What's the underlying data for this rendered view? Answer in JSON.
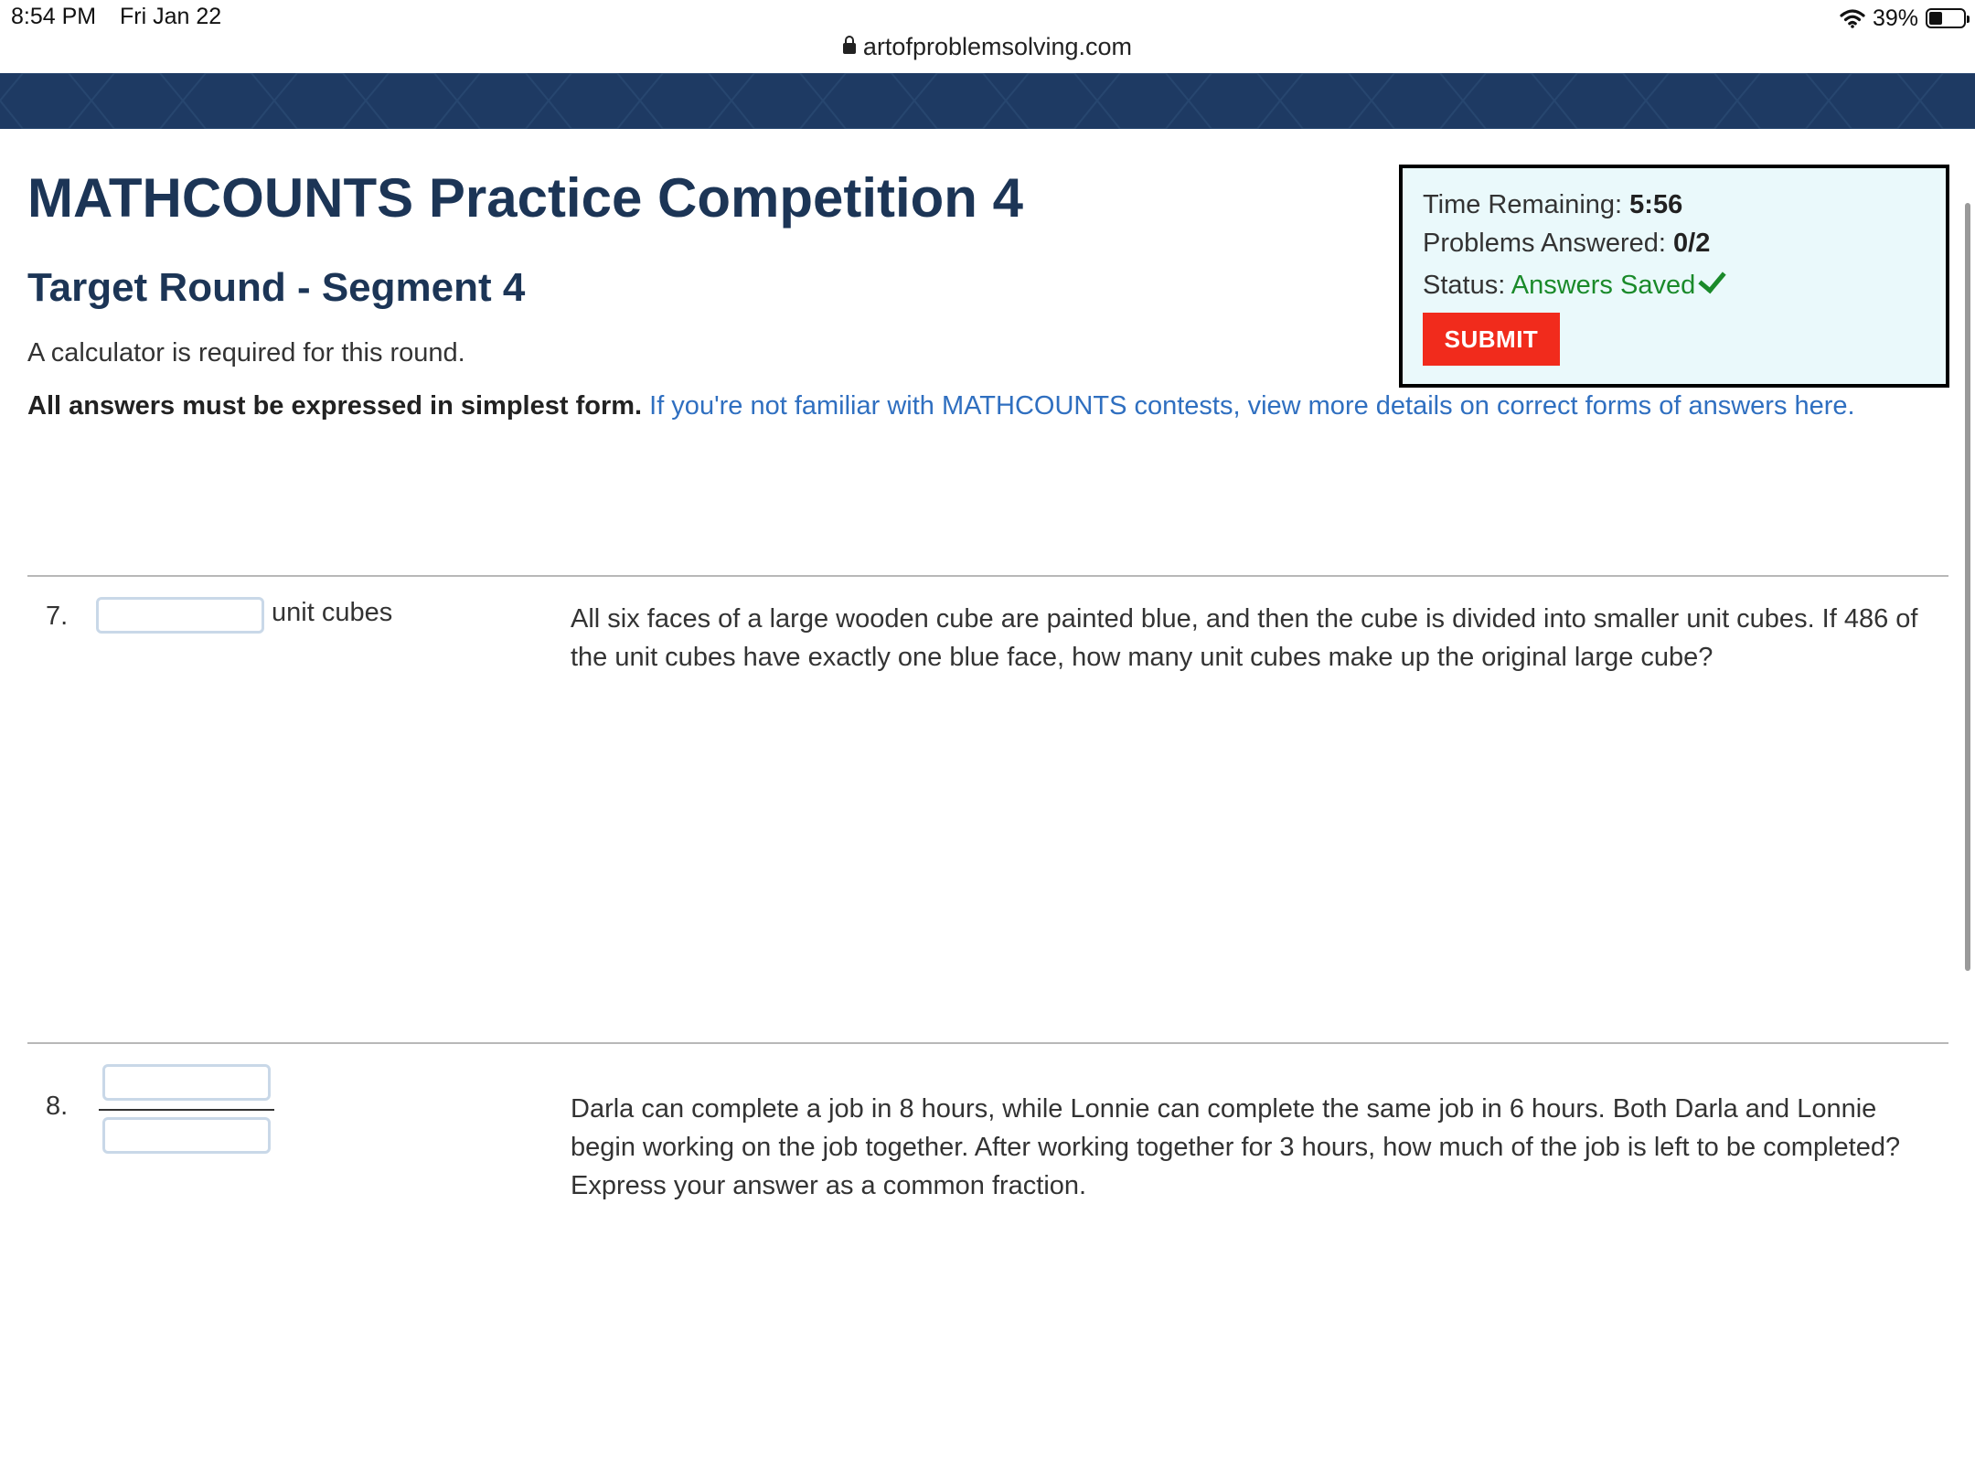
{
  "status_bar": {
    "time": "8:54 PM",
    "date": "Fri Jan 22",
    "url": "artofproblemsolving.com",
    "battery": "39%"
  },
  "page": {
    "title": "MATHCOUNTS Practice Competition 4",
    "round_title": "Target Round - Segment 4",
    "calculator_note": "A calculator is required for this round.",
    "answers_bold": "All answers must be expressed in simplest form.",
    "answers_link": "If you're not familiar with MATHCOUNTS contests, view more details on correct forms of answers here."
  },
  "status_box": {
    "time_label": "Time Remaining: ",
    "time_value": "5:56",
    "answered_label": "Problems Answered: ",
    "answered_value": "0/2",
    "status_label": "Status: ",
    "status_value": "Answers Saved",
    "submit_label": "SUBMIT"
  },
  "problems": [
    {
      "number": "7.",
      "answer_value": "",
      "unit": "unit cubes",
      "text": "All six faces of a large wooden cube are painted blue, and then the cube is divided into smaller unit cubes. If 486 of the unit cubes have exactly one blue face, how many unit cubes make up the original large cube?"
    },
    {
      "number": "8.",
      "numerator_value": "",
      "denominator_value": "",
      "text": "Darla can complete a job in 8 hours, while Lonnie can complete the same job in 6 hours. Both Darla and Lonnie begin working on the job together. After working together for 3 hours, how much of the job is left to be completed? Express your answer as a common fraction."
    }
  ],
  "colors": {
    "header_band": "#1e3a63",
    "title": "#1c3556",
    "link": "#2f6fc0",
    "submit": "#f12b1c",
    "status_box_bg": "#eaf9fb",
    "saved": "#1a8a2a"
  }
}
